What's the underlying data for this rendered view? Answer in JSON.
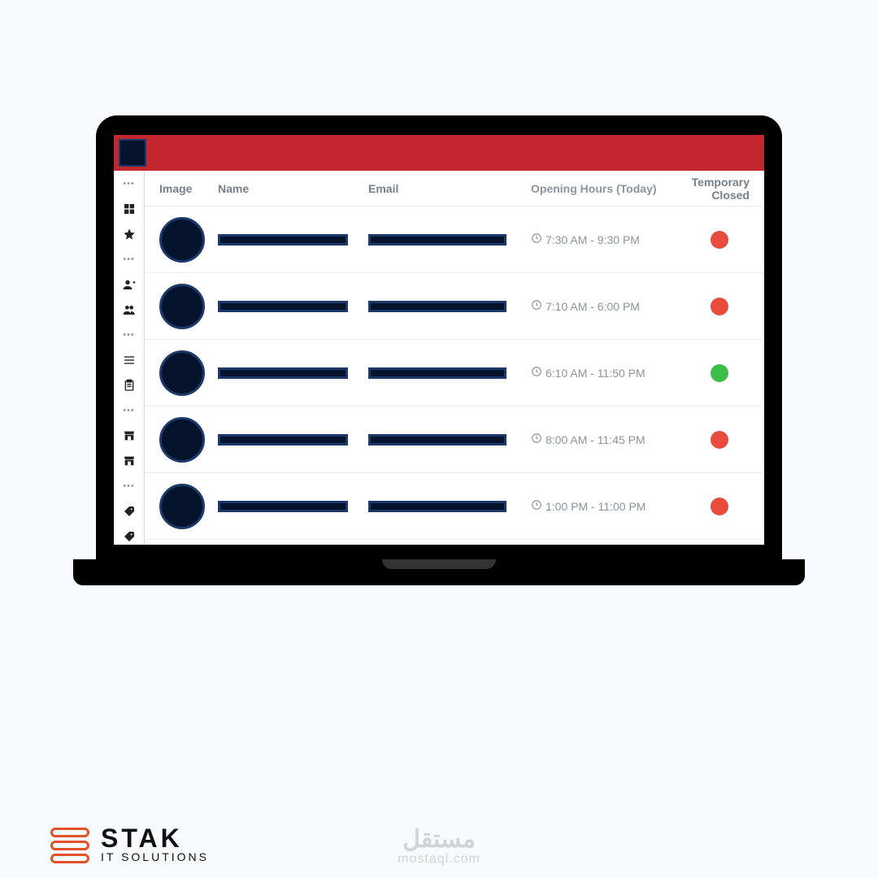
{
  "colors": {
    "accent_red": "#c1272d",
    "dark_navy": "#05132d",
    "navy_border": "#1b3a6b",
    "status_red": "#e74c3c",
    "status_green": "#3dbd4a"
  },
  "sidebar": {
    "items": [
      {
        "name": "dots-icon",
        "type": "dots"
      },
      {
        "name": "dashboard-icon",
        "type": "grid"
      },
      {
        "name": "star-icon",
        "type": "star"
      },
      {
        "name": "dots-icon",
        "type": "dots"
      },
      {
        "name": "person-add-icon",
        "type": "person-add"
      },
      {
        "name": "people-icon",
        "type": "people"
      },
      {
        "name": "dots-icon",
        "type": "dots"
      },
      {
        "name": "list-icon",
        "type": "list"
      },
      {
        "name": "clipboard-icon",
        "type": "clipboard"
      },
      {
        "name": "dots-icon",
        "type": "dots"
      },
      {
        "name": "store-icon",
        "type": "store"
      },
      {
        "name": "store-icon",
        "type": "store"
      },
      {
        "name": "dots-icon",
        "type": "dots"
      },
      {
        "name": "tag-icon",
        "type": "tag"
      },
      {
        "name": "tag-icon",
        "type": "tag"
      }
    ]
  },
  "table": {
    "headers": {
      "image": "Image",
      "name": "Name",
      "email": "Email",
      "hours": "Opening Hours (Today)",
      "closed": "Temporary Closed"
    },
    "rows": [
      {
        "hours": "7:30 AM - 9:30 PM",
        "closed_status": "red"
      },
      {
        "hours": "7:10 AM - 6:00 PM",
        "closed_status": "red"
      },
      {
        "hours": "6:10 AM - 11:50 PM",
        "closed_status": "green"
      },
      {
        "hours": "8:00 AM - 11:45 PM",
        "closed_status": "red"
      },
      {
        "hours": "1:00 PM - 11:00 PM",
        "closed_status": "red"
      }
    ]
  },
  "footer": {
    "brand": "STAK",
    "tagline": "IT SOLUTIONS"
  },
  "watermark": {
    "ar": "مستقل",
    "en": "mostaql.com"
  }
}
